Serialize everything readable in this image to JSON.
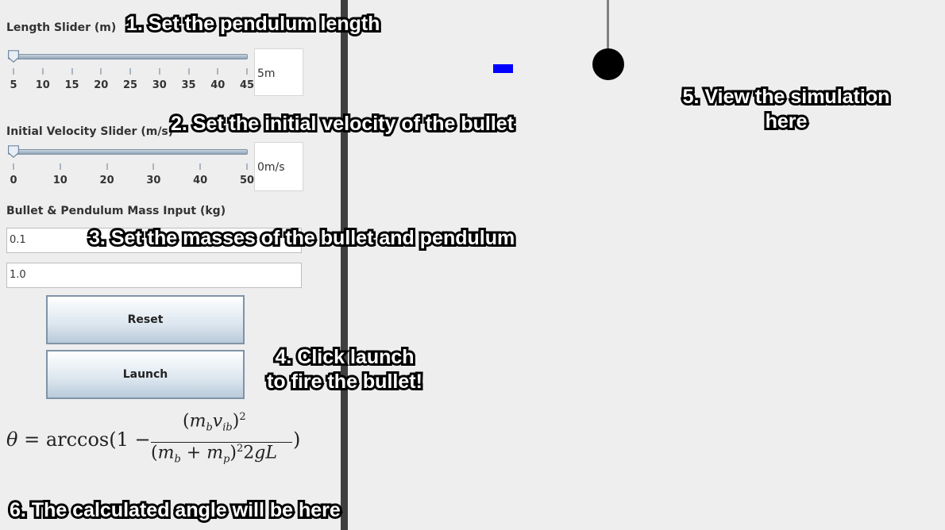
{
  "length_slider": {
    "label": "Length Slider (m)",
    "ticks": [
      "5",
      "10",
      "15",
      "20",
      "25",
      "30",
      "35",
      "40",
      "45"
    ],
    "value_display": "5m",
    "value": 5
  },
  "velocity_slider": {
    "label": "Initial Velocity Slider (m/s)",
    "ticks": [
      "0",
      "10",
      "20",
      "30",
      "40",
      "50"
    ],
    "value_display": "0m/s",
    "value": 0
  },
  "mass_input": {
    "label": "Bullet & Pendulum Mass Input (kg)",
    "bullet_mass": "0.1",
    "pendulum_mass": "1.0"
  },
  "buttons": {
    "reset": "Reset",
    "launch": "Launch"
  },
  "formula": {
    "lhs": "θ = arccos(1 −",
    "numerator": "(m_b v_ib)^2",
    "denominator": "(m_b + m_p)^2 2gL",
    "close": ")"
  },
  "callouts": {
    "step1": "1. Set the pendulum length",
    "step2": "2. Set the initial velocity of the bullet",
    "step3": "3. Set the masses of the bullet and pendulum",
    "step4_line1": "4. Click launch",
    "step4_line2": "to fire the bullet!",
    "step5_line1": "5. View the simulation",
    "step5_line2": "here",
    "step6": "6. The calculated angle will be here"
  },
  "colors": {
    "bullet": "#0000ff",
    "bob": "#000000",
    "divider": "#3f3f3f"
  }
}
